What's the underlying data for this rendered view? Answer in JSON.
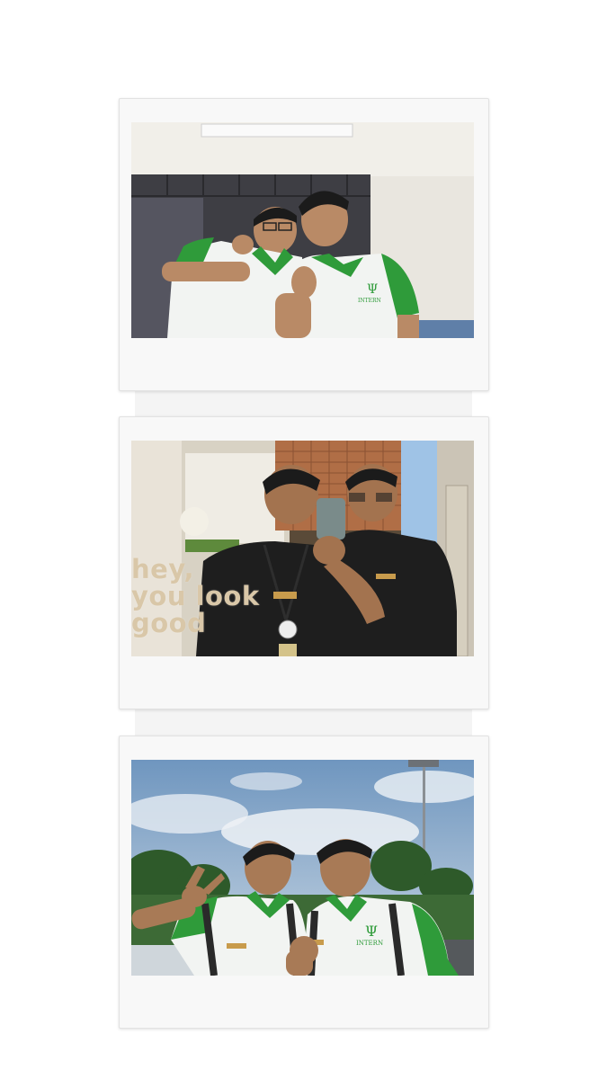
{
  "photo_strip": {
    "photos": [
      {
        "name": "photo-indoor-window"
      },
      {
        "name": "photo-mirror-selfie",
        "wall_text": [
          "hey,",
          "you look",
          "good"
        ]
      },
      {
        "name": "photo-outdoor-sky"
      }
    ],
    "colors": {
      "frame": "#f8f8f8",
      "uniform_green": "#2f9b3a",
      "shirt_white": "#f2f4f2",
      "shirt_black": "#1e1e1e",
      "sky_blue": "#8fb0cf"
    }
  }
}
